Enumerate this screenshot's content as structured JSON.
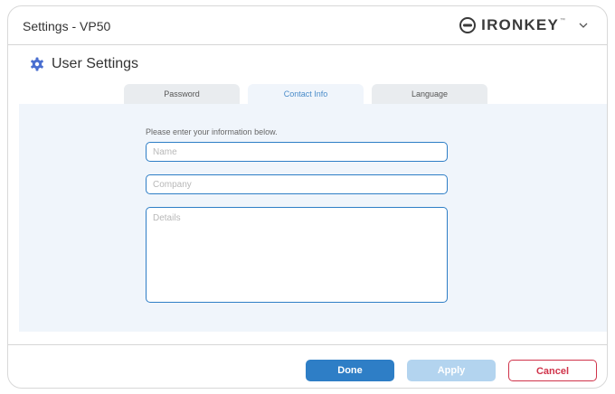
{
  "window": {
    "title": "Settings - VP50"
  },
  "brand": {
    "name": "IRONKEY",
    "trademark": "™",
    "logo_icon": "ironkey-logo-icon",
    "menu_icon": "chevron-down-icon"
  },
  "section": {
    "icon": "gear-icon",
    "title": "User Settings"
  },
  "tabs": [
    {
      "label": "Password",
      "active": false
    },
    {
      "label": "Contact Info",
      "active": true
    },
    {
      "label": "Language",
      "active": false
    }
  ],
  "form": {
    "instructions": "Please enter your information below.",
    "name": {
      "placeholder": "Name",
      "value": ""
    },
    "company": {
      "placeholder": "Company",
      "value": ""
    },
    "details": {
      "placeholder": "Details",
      "value": ""
    }
  },
  "footer": {
    "done_label": "Done",
    "apply_label": "Apply",
    "cancel_label": "Cancel"
  },
  "colors": {
    "accent": "#2e7ec6",
    "panel_background": "#f0f5fb",
    "apply_disabled": "#b3d4ef",
    "cancel_red": "#d0334a"
  }
}
